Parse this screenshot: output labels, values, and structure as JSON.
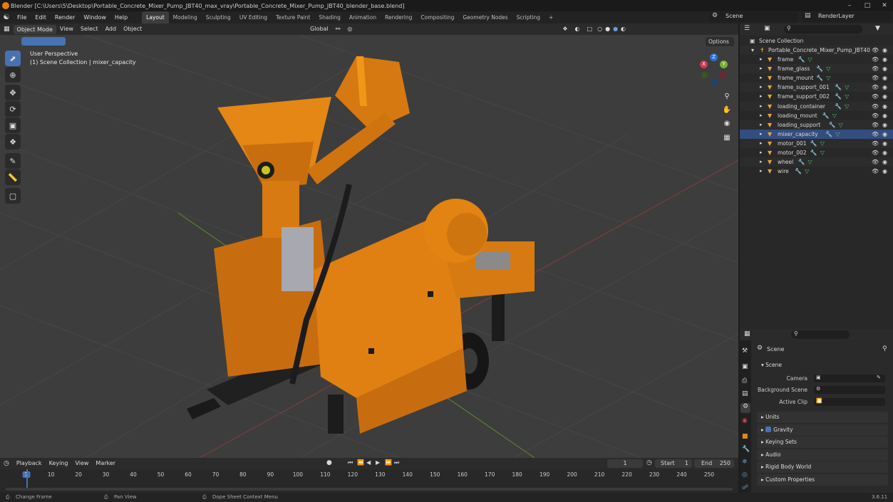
{
  "window": {
    "title": "Blender [C:\\Users\\5\\Desktop\\Portable_Concrete_Mixer_Pump_JBT40_max_vray\\Portable_Concrete_Mixer_Pump_JBT40_blender_base.blend]",
    "min": "–",
    "max": "□",
    "close": "✕"
  },
  "menu": [
    "File",
    "Edit",
    "Render",
    "Window",
    "Help"
  ],
  "workspaces": [
    "Layout",
    "Modeling",
    "Sculpting",
    "UV Editing",
    "Texture Paint",
    "Shading",
    "Animation",
    "Rendering",
    "Compositing",
    "Geometry Nodes",
    "Scripting"
  ],
  "active_workspace": "Layout",
  "add_workspace": "+",
  "scene_name": "Scene",
  "view_layer": "RenderLayer",
  "viewport_header": {
    "mode": "Object Mode",
    "menus": [
      "View",
      "Select",
      "Add",
      "Object"
    ],
    "transform_orientation": "Global",
    "options": "Options"
  },
  "viewport": {
    "perspective_label": "User Perspective",
    "collection_label": "(1) Scene Collection | mixer_capacity"
  },
  "gizmo": {
    "x": "X",
    "y": "Y",
    "z": "Z"
  },
  "outliner": {
    "root": "Scene Collection",
    "collection": "Portable_Concrete_Mixer_Pump_JBT40",
    "items": [
      "frame",
      "frame_glass",
      "frame_mount",
      "frame_support_001",
      "frame_support_002",
      "loading_container",
      "loading_mount",
      "loading_support",
      "mixer_capacity",
      "motor_001",
      "motor_002",
      "wheel",
      "wire"
    ],
    "selected": "mixer_capacity"
  },
  "properties": {
    "context": "Scene",
    "panel": "Scene",
    "fields": {
      "camera": "Camera",
      "background_scene": "Background Scene",
      "active_clip": "Active Clip"
    },
    "subpanels": [
      "Units",
      "Gravity",
      "Keying Sets",
      "Audio",
      "Rigid Body World",
      "Custom Properties"
    ]
  },
  "timeline": {
    "menus": [
      "Playback",
      "Keying",
      "View",
      "Marker"
    ],
    "current_frame": "1",
    "start_label": "Start",
    "start": "1",
    "end_label": "End",
    "end": "250",
    "ticks": [
      "1",
      "10",
      "20",
      "30",
      "40",
      "50",
      "60",
      "70",
      "80",
      "90",
      "100",
      "110",
      "120",
      "130",
      "140",
      "150",
      "160",
      "170",
      "180",
      "190",
      "200",
      "210",
      "220",
      "230",
      "240",
      "250"
    ]
  },
  "statusbar": {
    "hints": [
      "Change Frame",
      "Pan View",
      "Dope Sheet Context Menu"
    ],
    "version": "3.6.11"
  }
}
